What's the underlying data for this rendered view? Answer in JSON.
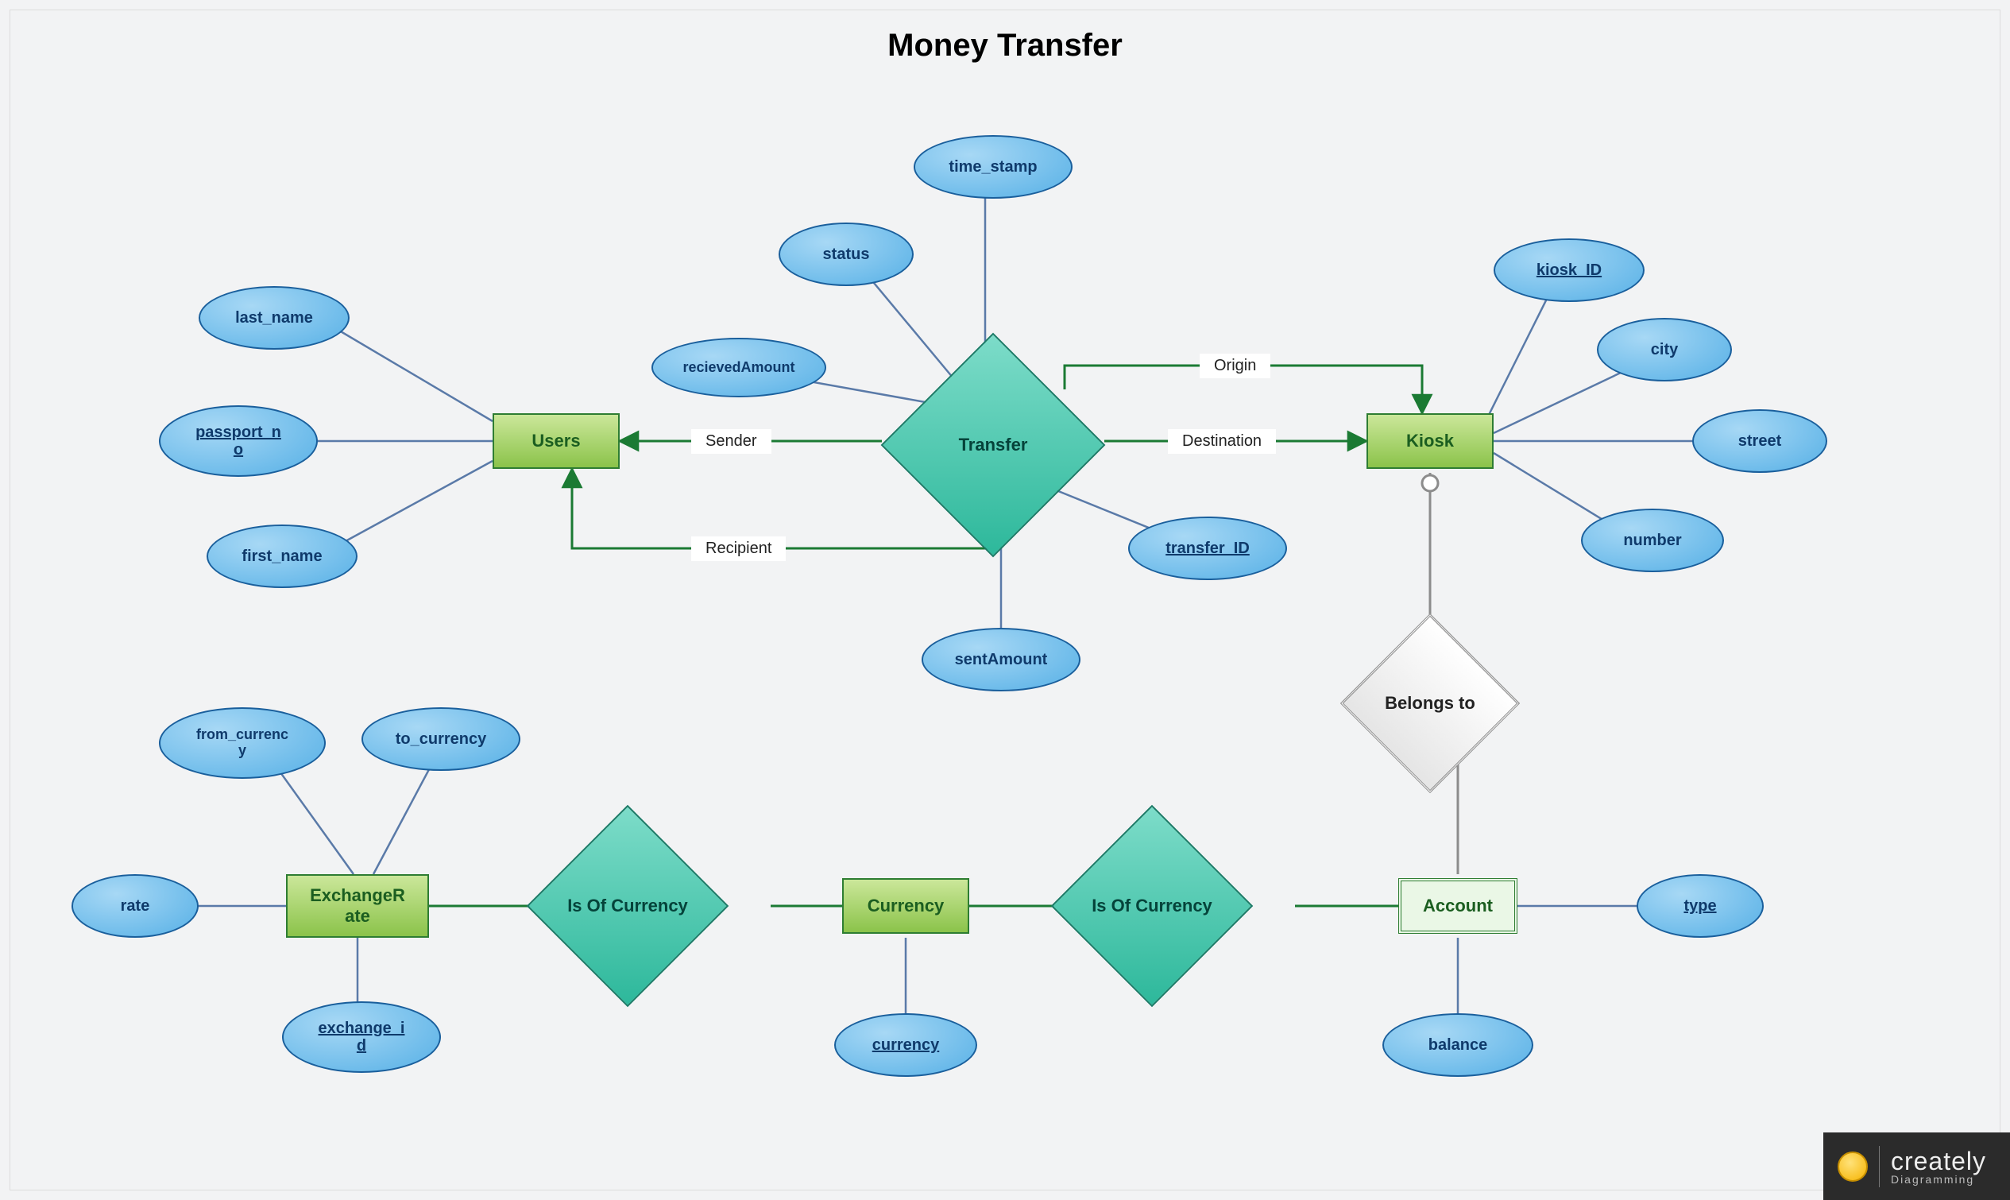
{
  "title": "Money Transfer",
  "entities": {
    "users": "Users",
    "kiosk": "Kiosk",
    "exchangeRate": "ExchangeR\nate",
    "currency": "Currency",
    "account": "Account"
  },
  "relationships": {
    "transfer": "Transfer",
    "isOfCurrency1": "Is Of Currency",
    "isOfCurrency2": "Is Of Currency",
    "belongsTo": "Belongs to"
  },
  "attributes": {
    "last_name": "last_name",
    "passport_no": "passport_n\no",
    "first_name": "first_name",
    "status": "status",
    "time_stamp": "time_stamp",
    "recievedAmount": "recievedAmount",
    "sentAmount": "sentAmount",
    "transfer_ID": "transfer_ID",
    "kiosk_ID": "kiosk_ID",
    "city": "city",
    "street": "street",
    "number": "number",
    "from_currency": "from_currenc\ny",
    "to_currency": "to_currency",
    "rate": "rate",
    "exchange_id": "exchange_i\nd",
    "currency_attr": "currency",
    "type": "type",
    "balance": "balance"
  },
  "edgeLabels": {
    "sender": "Sender",
    "recipient": "Recipient",
    "origin": "Origin",
    "destination": "Destination"
  },
  "badge": {
    "brand": "creately",
    "tagline": "Diagramming"
  }
}
